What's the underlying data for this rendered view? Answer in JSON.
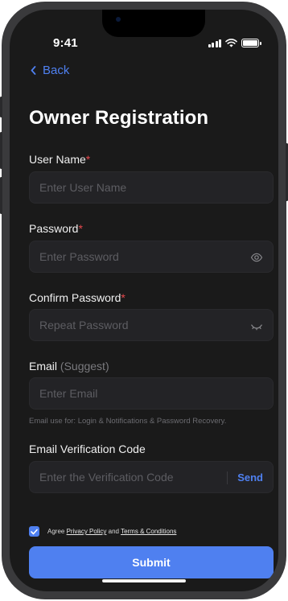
{
  "status_bar": {
    "time": "9:41"
  },
  "nav": {
    "back_label": "Back"
  },
  "page": {
    "title": "Owner Registration"
  },
  "form": {
    "username": {
      "label": "User Name",
      "required_mark": "*",
      "placeholder": "Enter User Name"
    },
    "password": {
      "label": "Password",
      "required_mark": "*",
      "placeholder": "Enter Password"
    },
    "confirm_password": {
      "label": "Confirm Password",
      "required_mark": "*",
      "placeholder": "Repeat Password"
    },
    "email": {
      "label": "Email",
      "suggest": "(Suggest)",
      "placeholder": "Enter Email",
      "hint": "Email use for: Login & Notifications & Password Recovery."
    },
    "verification": {
      "label": "Email Verification Code",
      "placeholder": "Enter the Verification Code",
      "send_label": "Send"
    }
  },
  "agreement": {
    "prefix": "Agree",
    "privacy_link": "Privacy Policy",
    "conjunction": "and",
    "terms_link": "Terms & Conditions",
    "checked": true
  },
  "submit_label": "Submit",
  "colors": {
    "accent": "#4f80f0",
    "background": "#1a1a1a",
    "field": "#232326",
    "required": "#e5484d"
  }
}
